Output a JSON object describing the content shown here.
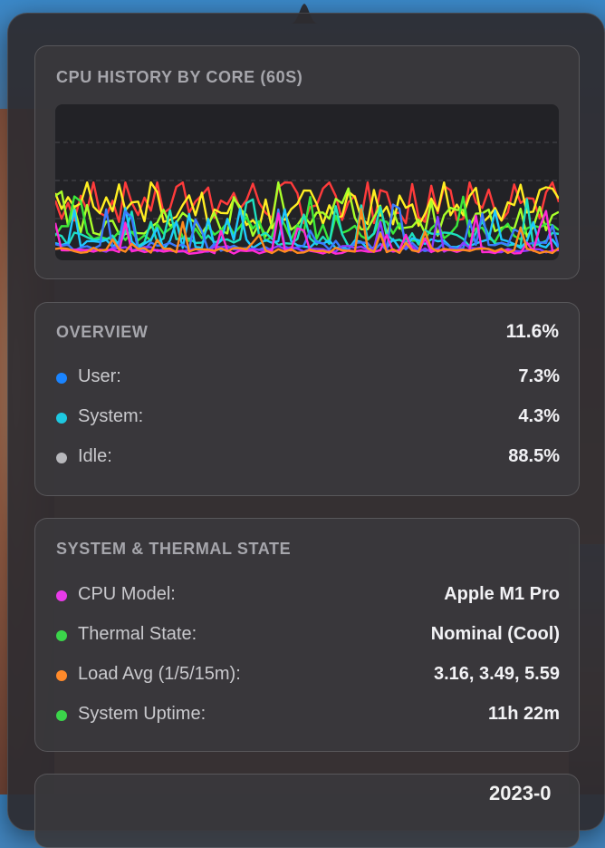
{
  "cpu_history": {
    "title": "CPU HISTORY BY CORE (60S)",
    "colors": [
      "#ff3b3b",
      "#ffee22",
      "#a8ff2a",
      "#3be83b",
      "#1ee0c0",
      "#1ec8ff",
      "#3b7bff",
      "#8a3bff",
      "#ff2ad4",
      "#ff8a1e"
    ]
  },
  "overview": {
    "title": "OVERVIEW",
    "total": "11.6%",
    "rows": [
      {
        "label": "User:",
        "value": "7.3%",
        "color": "#1a84ff"
      },
      {
        "label": "System:",
        "value": "4.3%",
        "color": "#1ec8e0"
      },
      {
        "label": "Idle:",
        "value": "88.5%",
        "color": "#b8b8bc"
      }
    ]
  },
  "system": {
    "title": "SYSTEM & THERMAL STATE",
    "rows": [
      {
        "label": "CPU Model:",
        "value": "Apple M1 Pro",
        "color": "#e83be8"
      },
      {
        "label": "Thermal State:",
        "value": "Nominal (Cool)",
        "color": "#3bd44a"
      },
      {
        "label": "Load Avg (1/5/15m):",
        "value": "3.16, 3.49, 5.59",
        "color": "#ff8a2a"
      },
      {
        "label": "System Uptime:",
        "value": "11h 22m",
        "color": "#3bd44a"
      }
    ]
  },
  "bottom_partial": "2023-0"
}
